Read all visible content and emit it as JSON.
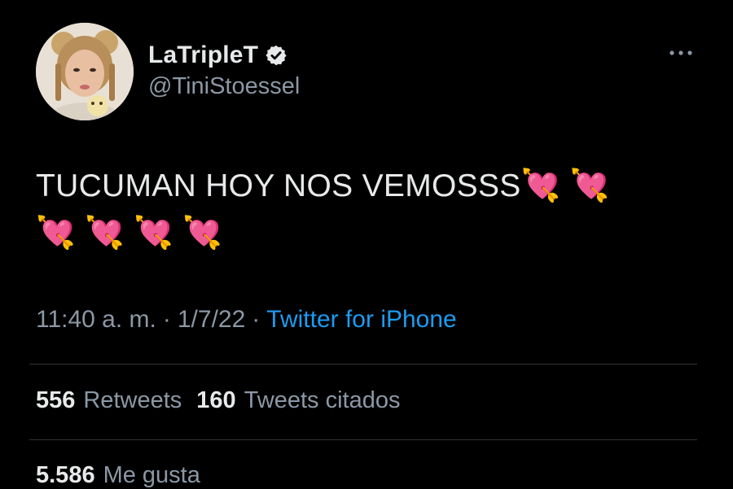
{
  "user": {
    "display_name": "LaTripleT",
    "handle": "@TiniStoessel",
    "verified": true
  },
  "tweet": {
    "text": "TUCUMAN HOY NOS VEMOSSS",
    "emojis": [
      "💘",
      "💘",
      "💘",
      "💘",
      "💘",
      "💘"
    ],
    "time": "11:40 a. m.",
    "separator": "·",
    "date": "1/7/22",
    "source": "Twitter for iPhone"
  },
  "stats": {
    "retweets_count": "556",
    "retweets_label": "Retweets",
    "quotes_count": "160",
    "quotes_label": "Tweets citados",
    "likes_count": "5.586",
    "likes_label": "Me gusta"
  },
  "colors": {
    "background": "#000000",
    "text": "#e7e9ea",
    "muted": "#8b98a5",
    "link": "#1d9bf0",
    "divider": "#2f3336"
  },
  "icons": {
    "verified": "verified-badge-icon",
    "more": "more-options-icon"
  }
}
